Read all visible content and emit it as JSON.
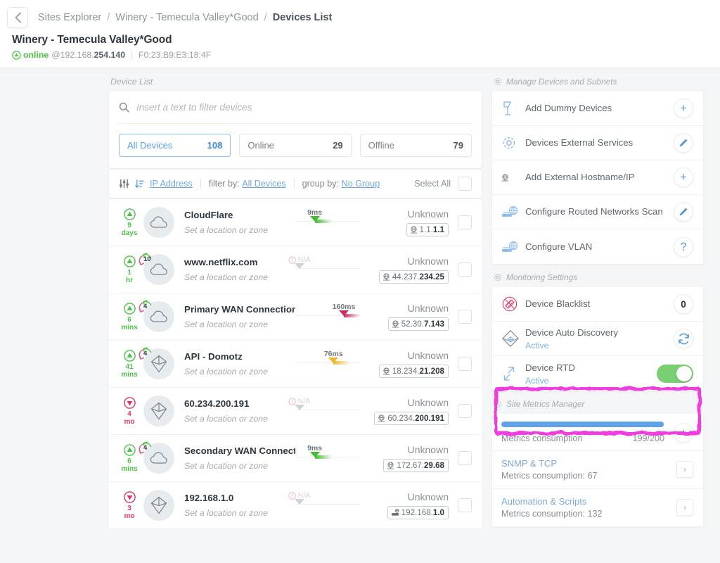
{
  "header": {
    "back_icon": "chevron-left-icon",
    "breadcrumbs": [
      {
        "label": "Sites Explorer",
        "current": false
      },
      {
        "label": "Winery - Temecula Valley*Good",
        "current": false
      },
      {
        "label": "Devices List",
        "current": true
      }
    ],
    "separator": "/",
    "site_title": "Winery - Temecula Valley*Good",
    "status_icon": "online-up-arrow-icon",
    "status_text": "online",
    "ip_prefix": "@192.168.",
    "ip_suffix": "254.140",
    "mac_address": "F0:23:B9:E3:18:4F"
  },
  "list": {
    "caption": "Device List",
    "search": {
      "icon": "search-icon",
      "placeholder": "Insert a text to filter devices",
      "value": ""
    },
    "pills": [
      {
        "label": "All Devices",
        "count": "108",
        "active": true
      },
      {
        "label": "Online",
        "count": "29",
        "active": false
      },
      {
        "label": "Offline",
        "count": "79",
        "active": false
      }
    ],
    "filterbar": {
      "settings_icon": "sliders-icon",
      "sort_icon": "sort-ascending-icon",
      "sort_label": "IP Address",
      "filter_prefix": "filter by:",
      "filter_value": "All Devices",
      "group_prefix": "group by:",
      "group_value": "No Group",
      "select_all_label": "Select All"
    },
    "unknown_label": "Unknown",
    "location_placeholder": "Set a location or zone",
    "devices": [
      {
        "name": "CloudFlare",
        "location": "Set a location or zone",
        "status": "up",
        "age_value": "9",
        "age_unit": "days",
        "refresh_count": null,
        "device_icon": "cloud-icon",
        "latency_label": "9ms",
        "latency_na": false,
        "latency_pct": 30,
        "latency_color": "#3fbf2f",
        "hostname": "Unknown",
        "ip_prefix": "1.1.",
        "ip_suffix": "1.1",
        "ip_icon": "globe-icon"
      },
      {
        "name": "www.netflix.com",
        "location": "Set a location or zone",
        "status": "up",
        "age_value": "1",
        "age_unit": "hr",
        "refresh_count": "10",
        "device_icon": "cloud-icon",
        "latency_label": "N/A",
        "latency_na": true,
        "latency_pct": 6,
        "latency_color": "#c9ccd0",
        "hostname": "Unknown",
        "ip_prefix": "44.237.",
        "ip_suffix": "234.25",
        "ip_icon": "globe-icon"
      },
      {
        "name": "Primary WAN Connection",
        "location": "Set a location or zone",
        "status": "up",
        "age_value": "6",
        "age_unit": "mins",
        "refresh_count": "4",
        "device_icon": "cloud-icon",
        "latency_label": "160ms",
        "latency_na": false,
        "latency_pct": 75,
        "latency_color": "#cf2a63",
        "hostname": "Unknown",
        "ip_prefix": "52.30.",
        "ip_suffix": "7.143",
        "ip_icon": "globe-icon"
      },
      {
        "name": "API - Domotz",
        "location": "Set a location or zone",
        "status": "up",
        "age_value": "41",
        "age_unit": "mins",
        "refresh_count": "4",
        "device_icon": "octahedron-icon",
        "latency_label": "76ms",
        "latency_na": false,
        "latency_pct": 59,
        "latency_color": "#f0b726",
        "hostname": "Unknown",
        "ip_prefix": "18.234.",
        "ip_suffix": "21.208",
        "ip_icon": "globe-icon"
      },
      {
        "name": "60.234.200.191",
        "location": "Set a location or zone",
        "status": "down",
        "age_value": "4",
        "age_unit": "mo",
        "refresh_count": null,
        "device_icon": "octahedron-icon",
        "latency_label": "N/A",
        "latency_na": true,
        "latency_pct": 6,
        "latency_color": "#c9ccd0",
        "hostname": "Unknown",
        "ip_prefix": "60.234.",
        "ip_suffix": "200.191",
        "ip_icon": "globe-icon"
      },
      {
        "name": "Secondary WAN Connectio",
        "location": "Set a location or zone",
        "status": "up",
        "age_value": "6",
        "age_unit": "mins",
        "refresh_count": "4",
        "device_icon": "cloud-icon",
        "latency_label": "9ms",
        "latency_na": false,
        "latency_pct": 30,
        "latency_color": "#3fbf2f",
        "hostname": "Unknown",
        "ip_prefix": "172.67.",
        "ip_suffix": "29.68",
        "ip_icon": "globe-icon"
      },
      {
        "name": "192.168.1.0",
        "location": "Set a location or zone",
        "status": "down",
        "age_value": "3",
        "age_unit": "mo",
        "refresh_count": null,
        "device_icon": "octahedron-icon",
        "latency_label": "N/A",
        "latency_na": true,
        "latency_pct": 6,
        "latency_color": "#c9ccd0",
        "hostname": "Unknown",
        "ip_prefix": "192.168.",
        "ip_suffix": "1.0",
        "ip_icon": "network-icon"
      }
    ]
  },
  "sidebar": {
    "manage": {
      "caption": "Manage Devices and Subnets",
      "caption_icon": "gear-icon",
      "items": [
        {
          "label": "Add Dummy Devices",
          "icon": "dummy-device-icon",
          "action": "+",
          "action_name": "add-button"
        },
        {
          "label": "Devices External Services",
          "icon": "gear-icon",
          "action": "pencil",
          "action_name": "edit-button"
        },
        {
          "label": "Add External Hostname/IP",
          "icon": "globe-icon",
          "action": "+",
          "action_name": "add-button"
        },
        {
          "label": "Configure Routed Networks Scan",
          "icon": "router-scan-icon",
          "action": "pencil",
          "action_name": "edit-button"
        },
        {
          "label": "Configure VLAN",
          "icon": "router-scan-icon",
          "action": "?",
          "action_name": "help-button"
        }
      ]
    },
    "monitoring": {
      "caption": "Monitoring Settings",
      "caption_icon": "gear-icon",
      "items": [
        {
          "label": "Device Blacklist",
          "sub": "",
          "icon": "blacklist-icon",
          "action": "0",
          "action_name": "blacklist-count-badge",
          "highlighted": false
        },
        {
          "label": "Device Auto Discovery",
          "sub": "Active",
          "icon": "auto-discovery-icon",
          "action": "refresh",
          "action_name": "refresh-button",
          "highlighted": true
        },
        {
          "label": "Device RTD",
          "sub": "Active",
          "icon": "rtd-icon",
          "action": "toggle-on",
          "action_name": "rtd-toggle",
          "highlighted": false
        }
      ]
    },
    "metrics": {
      "caption": "Site Metrics Manager",
      "caption_icon": "gear-icon",
      "consumption_label": "Metrics consumption",
      "consumption_value": "199/200",
      "consumption_pct": 99.5,
      "add_action": "+",
      "rows": [
        {
          "title": "SNMP & TCP",
          "sub": "Metrics consumption: 67",
          "action": "chevron-right-icon"
        },
        {
          "title": "Automation & Scripts",
          "sub": "Metrics consumption: 132",
          "action": "chevron-right-icon"
        }
      ]
    }
  },
  "colors": {
    "accent_blue": "#5c9de0",
    "online_green": "#49c343",
    "offline_pink": "#d8386e",
    "highlight_magenta": "#ef3ee0",
    "page_bg": "#f4f5f6"
  }
}
